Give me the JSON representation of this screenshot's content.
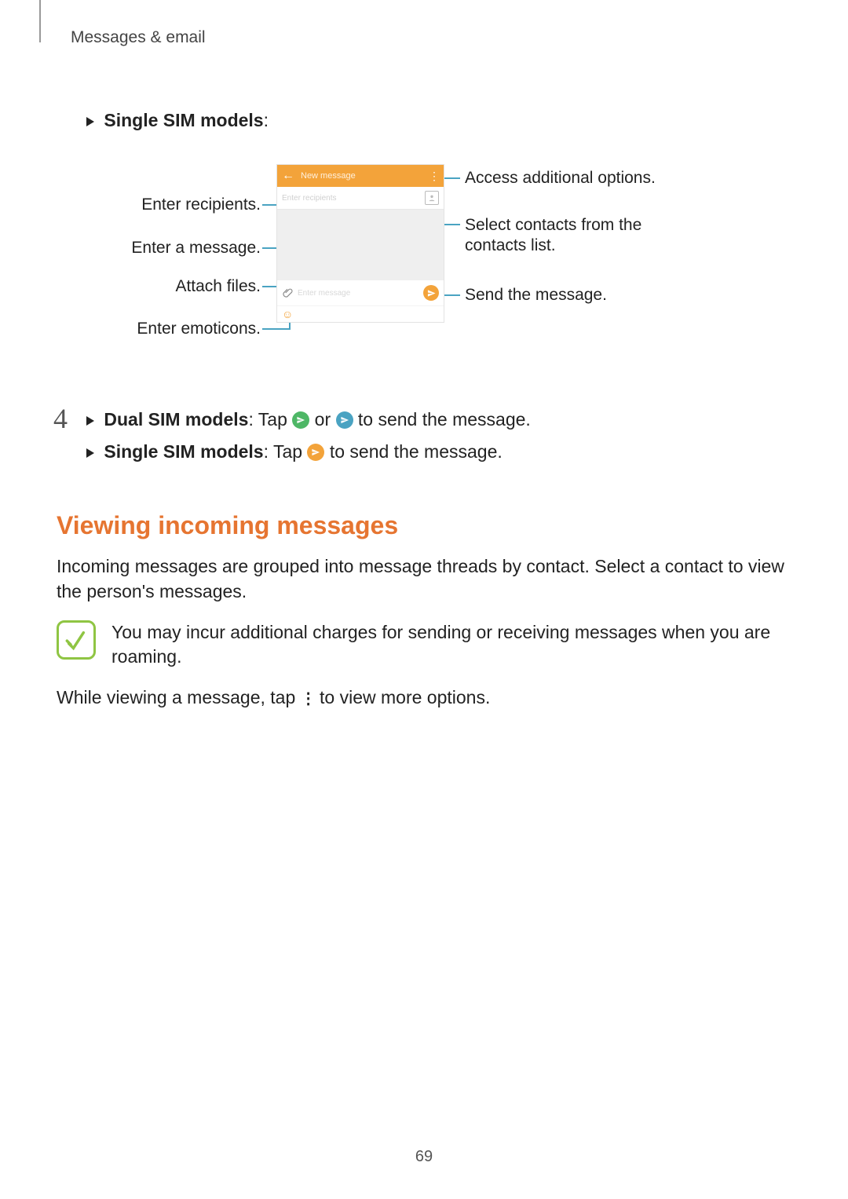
{
  "header": "Messages & email",
  "single_sim_label": "Single SIM models",
  "callouts": {
    "recipients": "Enter recipients.",
    "enter_message": "Enter a message.",
    "attach_files": "Attach files.",
    "enter_emoticons": "Enter emoticons.",
    "access_options": "Access additional options.",
    "select_contacts": "Select contacts from the contacts list.",
    "send_message": "Send the message."
  },
  "phone": {
    "title": "New message",
    "recipients_placeholder": "Enter recipients",
    "enter_message_placeholder": "Enter message"
  },
  "step4": {
    "number": "4",
    "dual_label": "Dual SIM models",
    "dual_pre": ": Tap ",
    "dual_mid": " or ",
    "dual_post": " to send the message.",
    "single_label": "Single SIM models",
    "single_pre": ": Tap ",
    "single_post": " to send the message."
  },
  "section_title": "Viewing incoming messages",
  "para1": "Incoming messages are grouped into message threads by contact. Select a contact to view the person's messages.",
  "note": "You may incur additional charges for sending or receiving messages when you are roaming.",
  "para2_pre": "While viewing a message, tap ",
  "para2_post": " to view more options.",
  "more_glyph": "⋮",
  "page_number": "69"
}
